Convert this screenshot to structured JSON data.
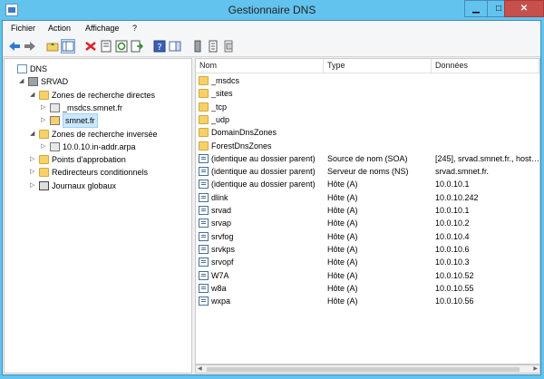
{
  "window": {
    "title": "Gestionnaire DNS",
    "minimize": "▁",
    "maximize": "□",
    "close": "✕"
  },
  "menu": [
    "Fichier",
    "Action",
    "Affichage",
    "?"
  ],
  "tree": [
    {
      "label": "DNS",
      "level": 0,
      "exp": "",
      "icon": "dns",
      "sel": false
    },
    {
      "label": "SRVAD",
      "level": 1,
      "exp": "◢",
      "icon": "server",
      "sel": false
    },
    {
      "label": "Zones de recherche directes",
      "level": 2,
      "exp": "◢",
      "icon": "folder",
      "sel": false
    },
    {
      "label": "_msdcs.smnet.fr",
      "level": 3,
      "exp": "▷",
      "icon": "zone",
      "sel": false
    },
    {
      "label": "smnet.fr",
      "level": 3,
      "exp": "▷",
      "icon": "zonesel",
      "sel": true
    },
    {
      "label": "Zones de recherche inversée",
      "level": 2,
      "exp": "◢",
      "icon": "folder",
      "sel": false
    },
    {
      "label": "10.0.10.in-addr.arpa",
      "level": 3,
      "exp": "▷",
      "icon": "zone",
      "sel": false
    },
    {
      "label": "Points d'approbation",
      "level": 2,
      "exp": "▷",
      "icon": "folder",
      "sel": false
    },
    {
      "label": "Redirecteurs conditionnels",
      "level": 2,
      "exp": "▷",
      "icon": "folder",
      "sel": false
    },
    {
      "label": "Journaux globaux",
      "level": 2,
      "exp": "▷",
      "icon": "log",
      "sel": false
    }
  ],
  "list": {
    "columns": [
      "Nom",
      "Type",
      "Données"
    ],
    "rows": [
      {
        "name": "_msdcs",
        "type": "",
        "data": "",
        "icon": "folder"
      },
      {
        "name": "_sites",
        "type": "",
        "data": "",
        "icon": "folder"
      },
      {
        "name": "_tcp",
        "type": "",
        "data": "",
        "icon": "folder"
      },
      {
        "name": "_udp",
        "type": "",
        "data": "",
        "icon": "folder"
      },
      {
        "name": "DomainDnsZones",
        "type": "",
        "data": "",
        "icon": "folder"
      },
      {
        "name": "ForestDnsZones",
        "type": "",
        "data": "",
        "icon": "folder"
      },
      {
        "name": "(identique au dossier parent)",
        "type": "Source de nom (SOA)",
        "data": "[245], srvad.smnet.fr., host…",
        "icon": "record"
      },
      {
        "name": "(identique au dossier parent)",
        "type": "Serveur de noms (NS)",
        "data": "srvad.smnet.fr.",
        "icon": "record"
      },
      {
        "name": "(identique au dossier parent)",
        "type": "Hôte (A)",
        "data": "10.0.10.1",
        "icon": "record"
      },
      {
        "name": "dlink",
        "type": "Hôte (A)",
        "data": "10.0.10.242",
        "icon": "record"
      },
      {
        "name": "srvad",
        "type": "Hôte (A)",
        "data": "10.0.10.1",
        "icon": "record"
      },
      {
        "name": "srvap",
        "type": "Hôte (A)",
        "data": "10.0.10.2",
        "icon": "record"
      },
      {
        "name": "srvfog",
        "type": "Hôte (A)",
        "data": "10.0.10.4",
        "icon": "record"
      },
      {
        "name": "srvkps",
        "type": "Hôte (A)",
        "data": "10.0.10.6",
        "icon": "record"
      },
      {
        "name": "srvopf",
        "type": "Hôte (A)",
        "data": "10.0.10.3",
        "icon": "record"
      },
      {
        "name": "W7A",
        "type": "Hôte (A)",
        "data": "10.0.10.52",
        "icon": "record"
      },
      {
        "name": "w8a",
        "type": "Hôte (A)",
        "data": "10.0.10.55",
        "icon": "record"
      },
      {
        "name": "wxpa",
        "type": "Hôte (A)",
        "data": "10.0.10.56",
        "icon": "record"
      }
    ]
  },
  "scroll": {
    "left": "◀",
    "right": "▶"
  }
}
